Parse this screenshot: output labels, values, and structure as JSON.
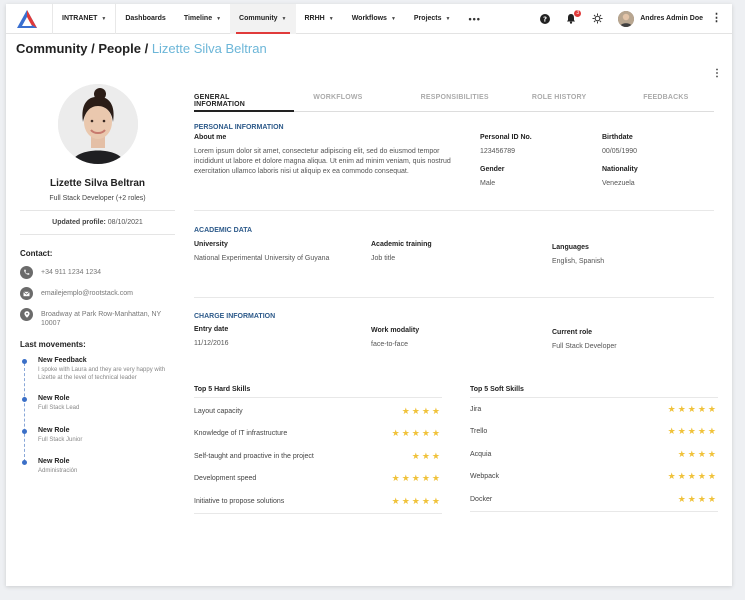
{
  "nav": {
    "items": [
      {
        "label": "INTRANET",
        "caret": true
      },
      {
        "label": "Dashboards",
        "caret": false
      },
      {
        "label": "Timeline",
        "caret": true
      },
      {
        "label": "Community",
        "caret": true
      },
      {
        "label": "RRHH",
        "caret": true
      },
      {
        "label": "Workflows",
        "caret": true
      },
      {
        "label": "Projects",
        "caret": true
      }
    ],
    "more": "•••",
    "notifications_count": "3",
    "user_name": "Andres Admin Doe",
    "accent": "#e03a3a"
  },
  "breadcrumb": {
    "part1": "Community",
    "sep": " / ",
    "part2": "People",
    "sep2": " / ",
    "current": "Lizette Silva Beltran"
  },
  "profile": {
    "name": "Lizette Silva Beltran",
    "role": "Full Stack Developer (+2 roles)",
    "updated_label": "Updated profile:",
    "updated_date": "08/10/2021",
    "contact_title": "Contact:",
    "phone": "+34 911 1234 1234",
    "email": "emailejemplo@rootstack.com",
    "address": "Broadway at Park Row-Manhattan, NY 10007",
    "movements_title": "Last movements:",
    "movements": [
      {
        "title": "New Feedback",
        "desc": "I spoke with Laura and they are very happy with Lizette at the level of technical leader"
      },
      {
        "title": "New Role",
        "desc": "Full Stack Lead"
      },
      {
        "title": "New Role",
        "desc": "Full Stack Junior"
      },
      {
        "title": "New Role",
        "desc": "Administración"
      }
    ]
  },
  "tabs": [
    "GENERAL INFORMATION",
    "WORKFLOWS",
    "RESPONSIBILITIES",
    "ROLE HISTORY",
    "FEEDBACKS"
  ],
  "personal": {
    "title": "PERSONAL INFORMATION",
    "about_label": "About me",
    "about": "Lorem ipsum dolor sit amet, consectetur adipiscing elit, sed do eiusmod tempor incididunt ut labore et dolore magna aliqua. Ut enim ad minim veniam, quis nostrud exercitation ullamco laboris nisi ut aliquip ex ea commodo consequat.",
    "id_label": "Personal ID No.",
    "id": "123456789",
    "birth_label": "Birthdate",
    "birth": "00/05/1990",
    "gender_label": "Gender",
    "gender": "Male",
    "nationality_label": "Nationality",
    "nationality": "Venezuela"
  },
  "academic": {
    "title": "ACADEMIC DATA",
    "university_label": "University",
    "university": "National Experimental University of Guyana",
    "training_label": "Academic training",
    "training": "Job title",
    "languages_label": "Languages",
    "languages": "English, Spanish"
  },
  "charge": {
    "title": "CHARGE INFORMATION",
    "entry_label": "Entry date",
    "entry": "11/12/2016",
    "modality_label": "Work modality",
    "modality": "face-to-face",
    "role_label": "Current role",
    "role": "Full Stack Developer"
  },
  "hard_skills": {
    "title": "Top 5 Hard Skills",
    "items": [
      {
        "name": "Layout capacity",
        "stars": 4
      },
      {
        "name": "Knowledge of IT infrastructure",
        "stars": 5
      },
      {
        "name": "Self-taught and proactive in the project",
        "stars": 3
      },
      {
        "name": "Development speed",
        "stars": 5
      },
      {
        "name": "Initiative to propose solutions",
        "stars": 5
      }
    ]
  },
  "soft_skills": {
    "title": "Top 5 Soft Skills",
    "items": [
      {
        "name": "Jira",
        "stars": 5
      },
      {
        "name": "Trello",
        "stars": 5
      },
      {
        "name": "Acquia",
        "stars": 4
      },
      {
        "name": "Webpack",
        "stars": 5
      },
      {
        "name": "Docker",
        "stars": 4
      }
    ]
  },
  "colors": {
    "star": "#f0c23a",
    "section_title": "#2d5a8a",
    "breadcrumb_current": "#6cb6d8"
  }
}
